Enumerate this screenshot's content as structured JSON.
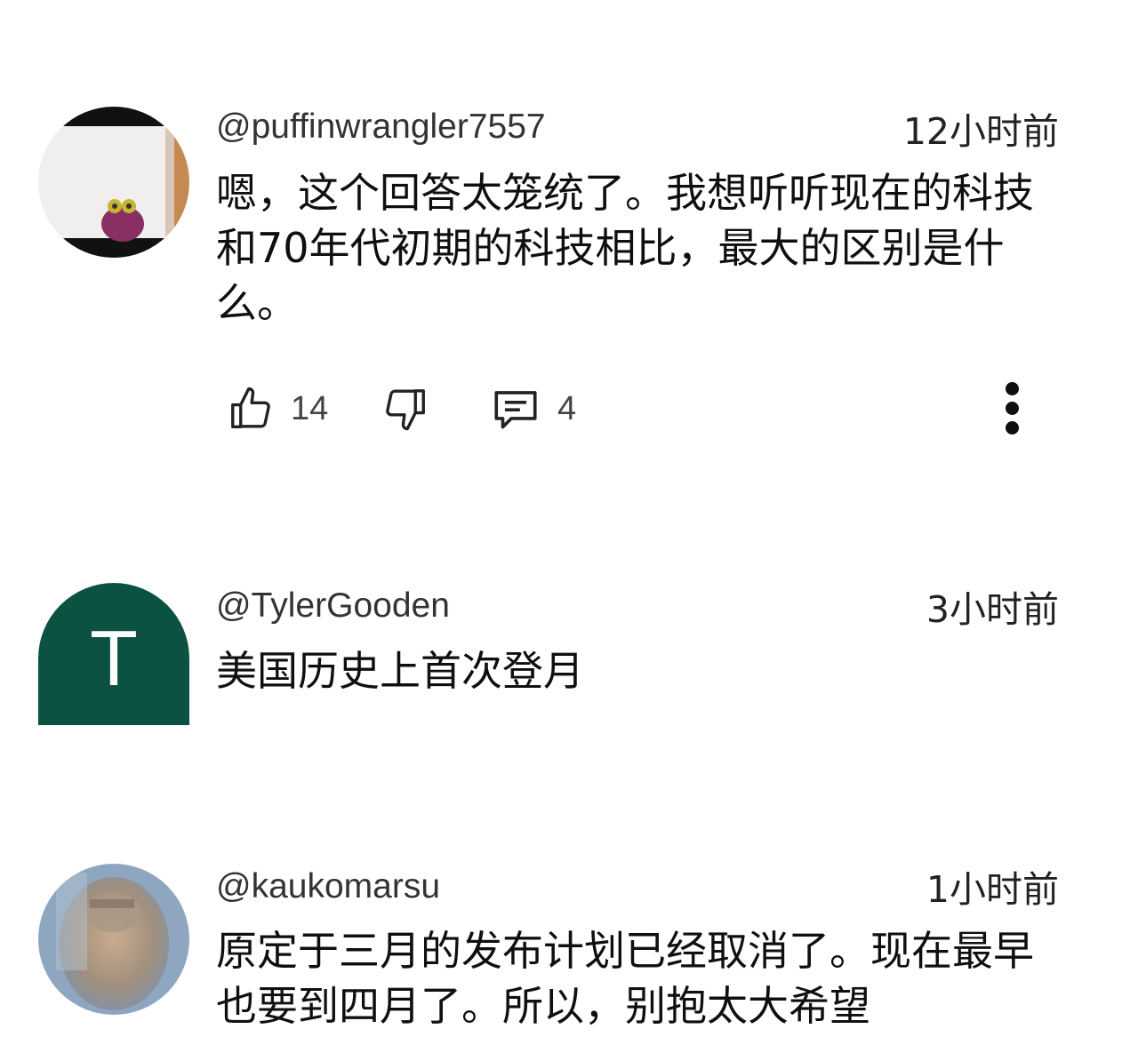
{
  "comments": [
    {
      "username": "@puffinwrangler7557",
      "time": "12小时前",
      "text": "嗯，这个回答太笼统了。我想听听现在的科技和70年代初期的科技相比，最大的区别是什么。",
      "likes": "14",
      "replies": "4"
    },
    {
      "username": "@TylerGooden",
      "time": "3小时前",
      "text": "美国历史上首次登月",
      "avatar_initial": "T",
      "avatar_color": "#0b5243"
    },
    {
      "username": "@kaukomarsu",
      "time": "1小时前",
      "text": "原定于三月的发布计划已经取消了。现在最早也要到四月了。所以，别抱太大希望"
    }
  ]
}
